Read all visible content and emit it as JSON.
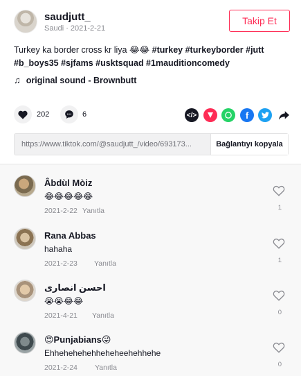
{
  "post": {
    "username": "saudjutt_",
    "meta": "Saudi · 2021-2-21",
    "follow_label": "Takip Et",
    "caption_text": "Turkey ka border cross kr liya 😂😂 ",
    "caption_hashtags_line1": "#turkey #turkeyborder #jutt",
    "caption_hashtags_line2": "#b_boys35 #sjfams #usktsquad #1mauditioncomedy",
    "sound": "original sound - Brownbutt",
    "likes": "202",
    "comments_count": "6",
    "link_url": "https://www.tiktok.com/@saudjutt_/video/693173...",
    "copy_label": "Bağlantıyı kopyala"
  },
  "colors": {
    "accent": "#fe2c55",
    "muted": "#8a8b91"
  },
  "icons": {
    "note": "music-note-icon",
    "like": "heart-icon",
    "comment": "comment-bubble-icon",
    "share": [
      "embed-icon",
      "send-icon",
      "whatsapp-icon",
      "facebook-icon",
      "twitter-icon",
      "share-arrow-icon"
    ]
  },
  "comments": [
    {
      "name": "Âbdùl Mòiz",
      "text": "😂😂😂😂😂",
      "date": "2021-2-22",
      "reply": "Yanıtla",
      "likes": "1"
    },
    {
      "name": "Rana Abbas",
      "text": "hahaha",
      "date": "2021-2-23",
      "reply": "Yanıtla",
      "likes": "1"
    },
    {
      "name": "احسن انصاری",
      "text": "😭😭😂😂",
      "date": "2021-4-21",
      "reply": "Yanıtla",
      "likes": "0"
    },
    {
      "name": "😍Punjabians😜",
      "text": "Ehhehehehehheheheehehhehe",
      "date": "2021-2-24",
      "reply": "Yanıtla",
      "likes": "0"
    }
  ]
}
